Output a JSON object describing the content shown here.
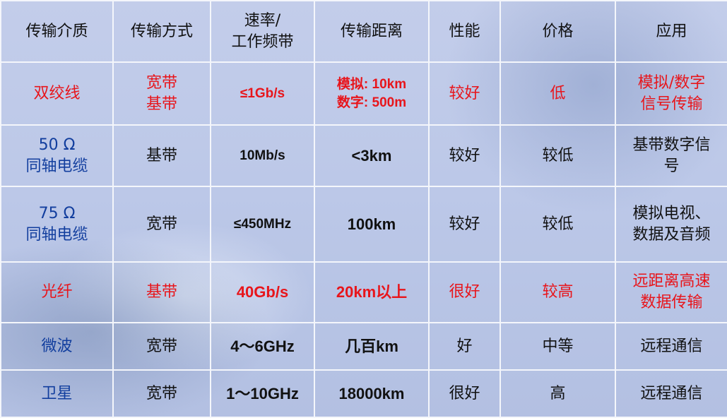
{
  "header": [
    "传输介质",
    "传输方式",
    "速率/\n工作频带",
    "传输距离",
    "性能",
    "价格",
    "应用"
  ],
  "rows": [
    {
      "medium": "双绞线",
      "mode": "宽带\n基带",
      "rate": "≤1Gb/s",
      "distance": "模拟: 10km\n数字: 500m",
      "performance": "较好",
      "price": "低",
      "application": "模拟/数字\n信号传输"
    },
    {
      "medium": "50 Ω\n同轴电缆",
      "mode": "基带",
      "rate": "10Mb/s",
      "distance": "<3km",
      "performance": "较好",
      "price": "较低",
      "application": "基带数字信\n号"
    },
    {
      "medium": "75 Ω\n同轴电缆",
      "mode": "宽带",
      "rate": "≤450MHz",
      "distance": "100km",
      "performance": "较好",
      "price": "较低",
      "application": "模拟电视、\n数据及音频"
    },
    {
      "medium": "光纤",
      "mode": "基带",
      "rate": "40Gb/s",
      "distance": "20km以上",
      "performance": "很好",
      "price": "较高",
      "application": "远距离高速\n数据传输"
    },
    {
      "medium": "微波",
      "mode": "宽带",
      "rate": "4～6GHz",
      "distance": "几百km",
      "performance": "好",
      "price": "中等",
      "application": "远程通信"
    },
    {
      "medium": "卫星",
      "mode": "宽带",
      "rate": "1～10GHz",
      "distance": "18000km",
      "performance": "很好",
      "price": "高",
      "application": "远程通信"
    }
  ],
  "colors": {
    "highlight": "#e8151b",
    "medium_label": "#123e9e",
    "text": "#111111",
    "grid": "#f4f6fb"
  }
}
